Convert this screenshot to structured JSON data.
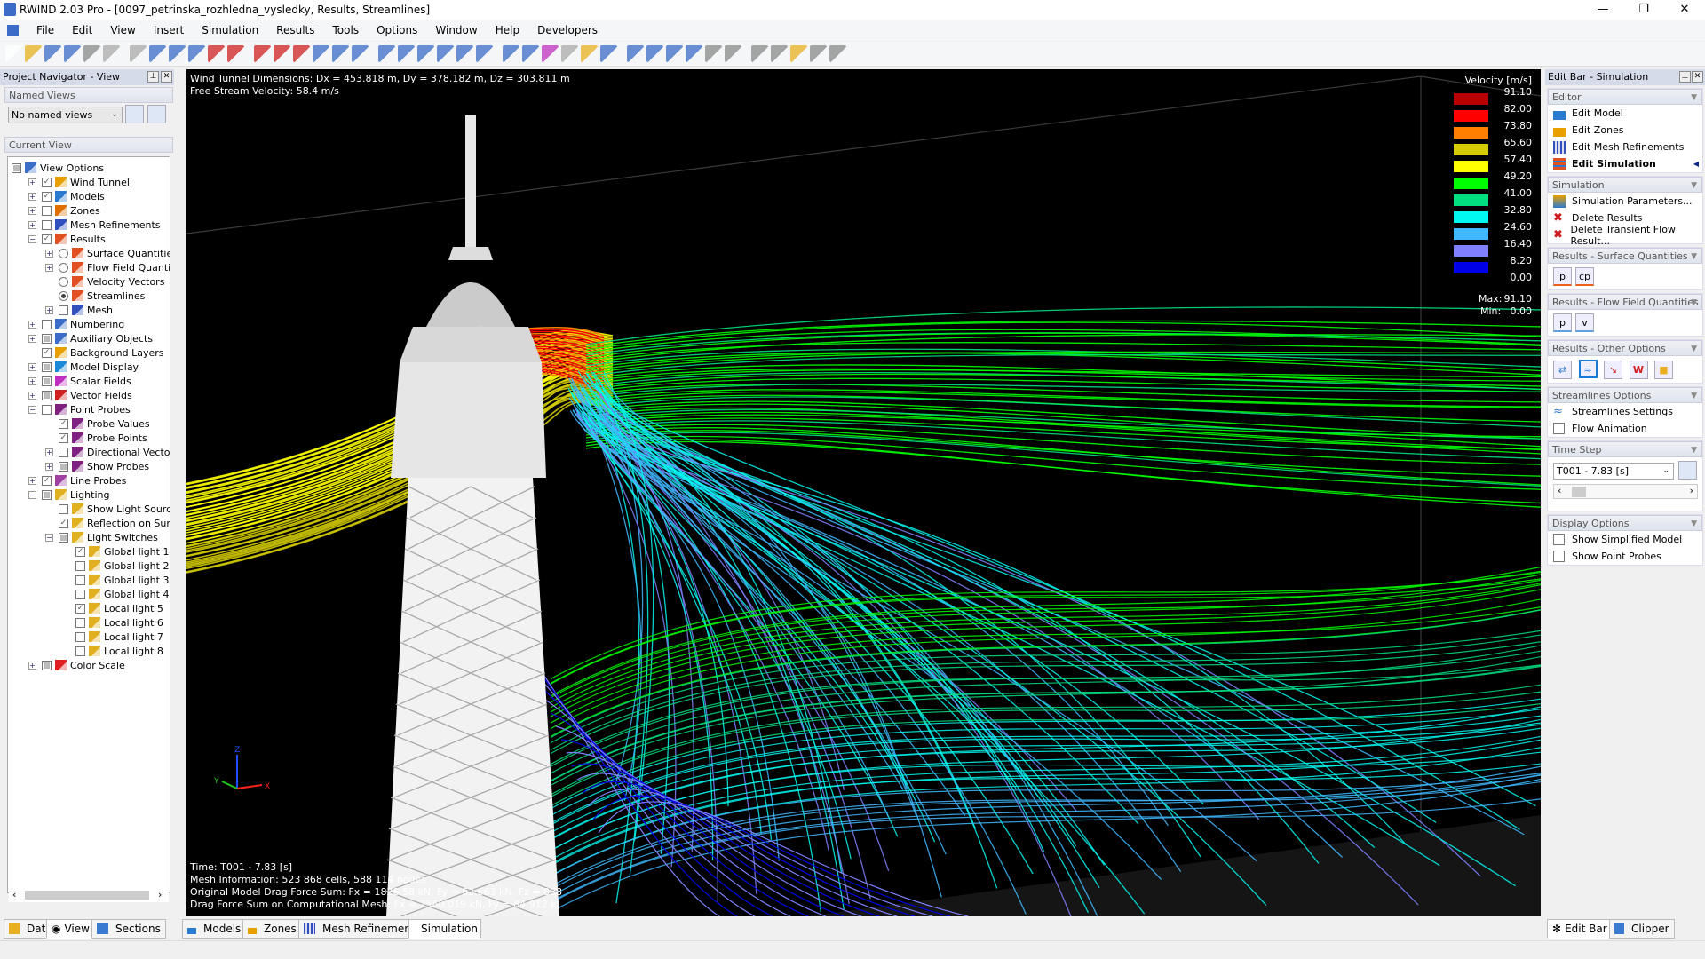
{
  "window": {
    "title": "RWIND 2.03 Pro - [0097_petrinska_rozhledna_vysledky, Results, Streamlines]",
    "controls": [
      "minimize",
      "restore",
      "close"
    ]
  },
  "menu": [
    "File",
    "Edit",
    "View",
    "Insert",
    "Simulation",
    "Results",
    "Tools",
    "Options",
    "Window",
    "Help",
    "Developers"
  ],
  "navigator": {
    "title": "Project Navigator - View",
    "named_views_header": "Named Views",
    "named_views_value": "No named views",
    "current_view_header": "Current View",
    "tree": [
      {
        "label": "View Options",
        "level": 0,
        "exp": "",
        "check": "partial",
        "icon": "view-options",
        "color": "#3a6cc8"
      },
      {
        "label": "Wind Tunnel",
        "level": 1,
        "exp": "+",
        "check": "checked",
        "icon": "wind-tunnel",
        "color": "#e8a000"
      },
      {
        "label": "Models",
        "level": 1,
        "exp": "+",
        "check": "checked",
        "icon": "models",
        "color": "#2a7ad0"
      },
      {
        "label": "Zones",
        "level": 1,
        "exp": "+",
        "check": "unchecked",
        "icon": "zones",
        "color": "#e07000"
      },
      {
        "label": "Mesh Refinements",
        "level": 1,
        "exp": "+",
        "check": "unchecked",
        "icon": "mesh",
        "color": "#3050c0"
      },
      {
        "label": "Results",
        "level": 1,
        "exp": "-",
        "check": "checked",
        "icon": "results",
        "color": "#e05020"
      },
      {
        "label": "Surface Quantities",
        "level": 2,
        "exp": "+",
        "check": "radio",
        "icon": "results",
        "color": "#e05020"
      },
      {
        "label": "Flow Field Quantities",
        "level": 2,
        "exp": "+",
        "check": "radio",
        "icon": "results",
        "color": "#e05020"
      },
      {
        "label": "Velocity Vectors",
        "level": 2,
        "exp": "",
        "check": "radio",
        "icon": "results",
        "color": "#e05020"
      },
      {
        "label": "Streamlines",
        "level": 2,
        "exp": "",
        "check": "radio-on",
        "icon": "results",
        "color": "#e05020"
      },
      {
        "label": "Mesh",
        "level": 2,
        "exp": "+",
        "check": "unchecked",
        "icon": "mesh",
        "color": "#3050c0"
      },
      {
        "label": "Numbering",
        "level": 1,
        "exp": "+",
        "check": "unchecked",
        "icon": "numbering",
        "color": "#3a6cc8"
      },
      {
        "label": "Auxiliary Objects",
        "level": 1,
        "exp": "+",
        "check": "partial",
        "icon": "auxiliary",
        "color": "#3a6cc8"
      },
      {
        "label": "Background Layers",
        "level": 1,
        "exp": "",
        "check": "checked",
        "icon": "layers",
        "color": "#e8a000"
      },
      {
        "label": "Model Display",
        "level": 1,
        "exp": "+",
        "check": "partial",
        "icon": "cube",
        "color": "#1a8ad8"
      },
      {
        "label": "Scalar Fields",
        "level": 1,
        "exp": "+",
        "check": "partial",
        "icon": "scalar",
        "color": "#c030c0"
      },
      {
        "label": "Vector Fields",
        "level": 1,
        "exp": "+",
        "check": "partial",
        "icon": "vector",
        "color": "#d02020"
      },
      {
        "label": "Point Probes",
        "level": 1,
        "exp": "-",
        "check": "unchecked",
        "icon": "probe",
        "color": "#802080"
      },
      {
        "label": "Probe Values",
        "level": 2,
        "exp": "",
        "check": "checked",
        "icon": "probe",
        "color": "#802080"
      },
      {
        "label": "Probe Points",
        "level": 2,
        "exp": "",
        "check": "checked",
        "icon": "probe",
        "color": "#802080"
      },
      {
        "label": "Directional Vectors",
        "level": 2,
        "exp": "+",
        "check": "unchecked",
        "icon": "probe",
        "color": "#802080"
      },
      {
        "label": "Show Probes",
        "level": 2,
        "exp": "+",
        "check": "partial",
        "icon": "probe",
        "color": "#802080"
      },
      {
        "label": "Line Probes",
        "level": 1,
        "exp": "+",
        "check": "checked",
        "icon": "line-probe",
        "color": "#a040a0"
      },
      {
        "label": "Lighting",
        "level": 1,
        "exp": "-",
        "check": "partial",
        "icon": "light",
        "color": "#e0b020"
      },
      {
        "label": "Show Light Sources",
        "level": 2,
        "exp": "",
        "check": "unchecked",
        "icon": "light",
        "color": "#e0b020"
      },
      {
        "label": "Reflection on Surfaces",
        "level": 2,
        "exp": "",
        "check": "checked",
        "icon": "light",
        "color": "#e0b020"
      },
      {
        "label": "Light Switches",
        "level": 2,
        "exp": "-",
        "check": "partial",
        "icon": "light",
        "color": "#e0b020"
      },
      {
        "label": "Global light 1",
        "level": 3,
        "exp": "",
        "check": "checked",
        "icon": "light",
        "color": "#e0b020"
      },
      {
        "label": "Global light 2",
        "level": 3,
        "exp": "",
        "check": "unchecked",
        "icon": "light",
        "color": "#e0b020"
      },
      {
        "label": "Global light 3",
        "level": 3,
        "exp": "",
        "check": "unchecked",
        "icon": "light",
        "color": "#e0b020"
      },
      {
        "label": "Global light 4",
        "level": 3,
        "exp": "",
        "check": "unchecked",
        "icon": "light",
        "color": "#e0b020"
      },
      {
        "label": "Local light 5",
        "level": 3,
        "exp": "",
        "check": "checked",
        "icon": "light",
        "color": "#e0b020"
      },
      {
        "label": "Local light 6",
        "level": 3,
        "exp": "",
        "check": "unchecked",
        "icon": "light",
        "color": "#e0b020"
      },
      {
        "label": "Local light 7",
        "level": 3,
        "exp": "",
        "check": "unchecked",
        "icon": "light",
        "color": "#e0b020"
      },
      {
        "label": "Local light 8",
        "level": 3,
        "exp": "",
        "check": "unchecked",
        "icon": "light",
        "color": "#e0b020"
      },
      {
        "label": "Color Scale",
        "level": 1,
        "exp": "+",
        "check": "partial",
        "icon": "color-scale",
        "color": "#e02020"
      }
    ],
    "tabs": [
      "Data",
      "View",
      "Sections"
    ],
    "active_tab": "View"
  },
  "viewport": {
    "info_top": [
      "Wind Tunnel Dimensions: Dx = 453.818 m, Dy = 378.182 m, Dz = 303.811 m",
      "Free Stream Velocity: 58.4 m/s"
    ],
    "info_bottom": [
      "Time: T001 - 7.83 [s]",
      "Mesh Information: 523 868 cells, 588 114 nodes",
      "Original Model Drag Force Sum: Fx = 1828.58 kN, Fy = 62.663 kN, Fz = 888",
      "Drag Force Sum on Computational Mesh: Fx = 2560.019 kN, Fy = 84.912 k"
    ],
    "axes": {
      "x": "X",
      "y": "Y",
      "z": "Z"
    },
    "legend": {
      "title": "Velocity [m/s]",
      "values": [
        "91.10",
        "82.00",
        "73.80",
        "65.60",
        "57.40",
        "49.20",
        "41.00",
        "32.80",
        "24.60",
        "16.40",
        "8.20",
        "0.00"
      ],
      "colors": [
        "#b80000",
        "#ff0000",
        "#ff8000",
        "#d4cc00",
        "#ffff00",
        "#00ff00",
        "#00e080",
        "#00f8f0",
        "#40b8ff",
        "#8080ff",
        "#0000e8"
      ],
      "max_label": "Max:",
      "max": "91.10",
      "min_label": "Min:",
      "min": "0.00"
    },
    "tabs": [
      "Models",
      "Zones",
      "Mesh Refinements",
      "Simulation"
    ],
    "active_tab": "Simulation"
  },
  "editbar": {
    "title": "Edit Bar - Simulation",
    "editor": {
      "header": "Editor",
      "items": [
        "Edit Model",
        "Edit Zones",
        "Edit Mesh Refinements",
        "Edit Simulation"
      ]
    },
    "simulation": {
      "header": "Simulation",
      "items": [
        "Simulation Parameters...",
        "Delete Results",
        "Delete Transient Flow Result..."
      ]
    },
    "surface": {
      "header": "Results - Surface Quantities",
      "buttons": [
        "p",
        "cp"
      ]
    },
    "flowfield": {
      "header": "Results - Flow Field Quantities",
      "buttons": [
        "p",
        "v"
      ]
    },
    "other": {
      "header": "Results - Other Options"
    },
    "streamlines": {
      "header": "Streamlines Options",
      "settings": "Streamlines Settings",
      "animation": "Flow Animation",
      "animation_checked": false
    },
    "timestep": {
      "header": "Time Step",
      "value": "T001 - 7.83 [s]"
    },
    "display": {
      "header": "Display Options",
      "items": [
        {
          "label": "Show Simplified Model",
          "checked": false
        },
        {
          "label": "Show Point Probes",
          "checked": false
        }
      ]
    },
    "tabs": [
      "Edit Bar",
      "Clipper"
    ],
    "active_tab": "Edit Bar"
  }
}
